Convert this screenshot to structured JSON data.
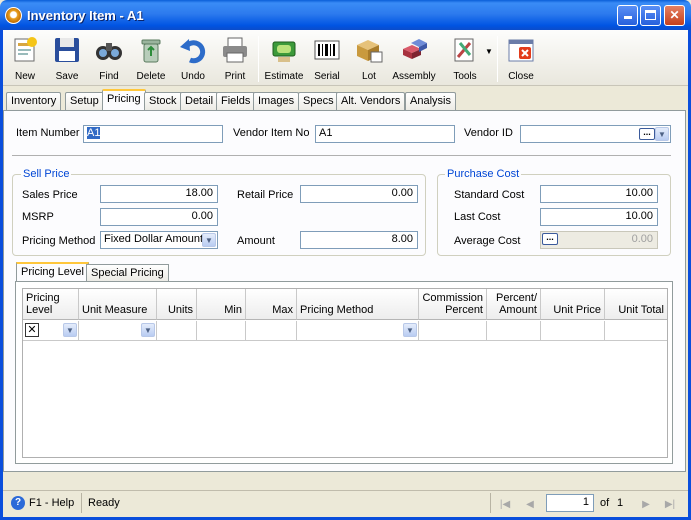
{
  "window": {
    "title": "Inventory Item - A1"
  },
  "toolbar": {
    "new": "New",
    "save": "Save",
    "find": "Find",
    "delete": "Delete",
    "undo": "Undo",
    "print": "Print",
    "estimate": "Estimate",
    "serial": "Serial",
    "lot": "Lot",
    "assembly": "Assembly",
    "tools": "Tools",
    "close": "Close"
  },
  "tabs": [
    "Inventory",
    "Setup",
    "Pricing",
    "Stock",
    "Detail",
    "Fields",
    "Images",
    "Specs",
    "Alt. Vendors",
    "Analysis"
  ],
  "header": {
    "item_number_label": "Item Number",
    "item_number": "A1",
    "vendor_item_no_label": "Vendor Item No",
    "vendor_item_no": "A1",
    "vendor_id_label": "Vendor ID",
    "vendor_id": ""
  },
  "sell_price": {
    "title": "Sell Price",
    "sales_price_label": "Sales Price",
    "sales_price": "18.00",
    "retail_price_label": "Retail Price",
    "retail_price": "0.00",
    "msrp_label": "MSRP",
    "msrp": "0.00",
    "pricing_method_label": "Pricing Method",
    "pricing_method": "Fixed Dollar Amount",
    "amount_label": "Amount",
    "amount": "8.00"
  },
  "purchase_cost": {
    "title": "Purchase Cost",
    "standard_cost_label": "Standard Cost",
    "standard_cost": "10.00",
    "last_cost_label": "Last Cost",
    "last_cost": "10.00",
    "average_cost_label": "Average Cost",
    "average_cost": "0.00"
  },
  "inner_tabs": [
    "Pricing Level",
    "Special Pricing"
  ],
  "grid": {
    "columns": [
      {
        "l1": "Pricing",
        "l2": "Level"
      },
      {
        "l1": "",
        "l2": "Unit Measure"
      },
      {
        "l1": "",
        "l2": "Units"
      },
      {
        "l1": "",
        "l2": "Min"
      },
      {
        "l1": "",
        "l2": "Max"
      },
      {
        "l1": "",
        "l2": "Pricing Method"
      },
      {
        "l1": "Commission",
        "l2": "Percent"
      },
      {
        "l1": "Percent/",
        "l2": "Amount"
      },
      {
        "l1": "",
        "l2": "Unit Price"
      },
      {
        "l1": "",
        "l2": "Unit Total"
      }
    ]
  },
  "status": {
    "help": "F1 - Help",
    "state": "Ready",
    "page": "1",
    "of_label": "of",
    "total": "1"
  }
}
